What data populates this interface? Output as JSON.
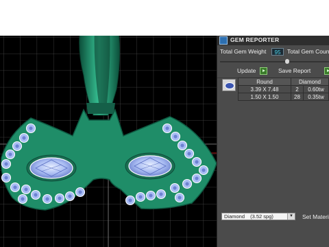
{
  "gem_reporter": {
    "title": "GEM REPORTER",
    "total_gem_weight_label": "Total Gem Weight",
    "total_gem_weight_value": "95",
    "total_gem_count_label": "Total Gem Coun",
    "update_label": "Update",
    "save_report_label": "Save Report",
    "table": {
      "headers": [
        "Round",
        "Diamond"
      ],
      "rows": [
        [
          "3.39 X 7.48",
          "2",
          "0.60tw"
        ],
        [
          "1.50 X 1.50",
          "28",
          "0.35tw"
        ]
      ]
    },
    "material_selected": "Diamond",
    "material_spg": "(3.52 spg)",
    "set_material_label": "Set Materia"
  },
  "colors": {
    "panel_bg": "#4b4b4b",
    "viewport_bg": "#000000",
    "model_green": "#1f8d68",
    "gem_blue": "#9fb6f0"
  },
  "icons": {
    "panel": "gem-reporter-logo-icon",
    "update": "play-green-icon",
    "save": "play-green-icon",
    "gem_shape": "oval-gem-icon"
  }
}
